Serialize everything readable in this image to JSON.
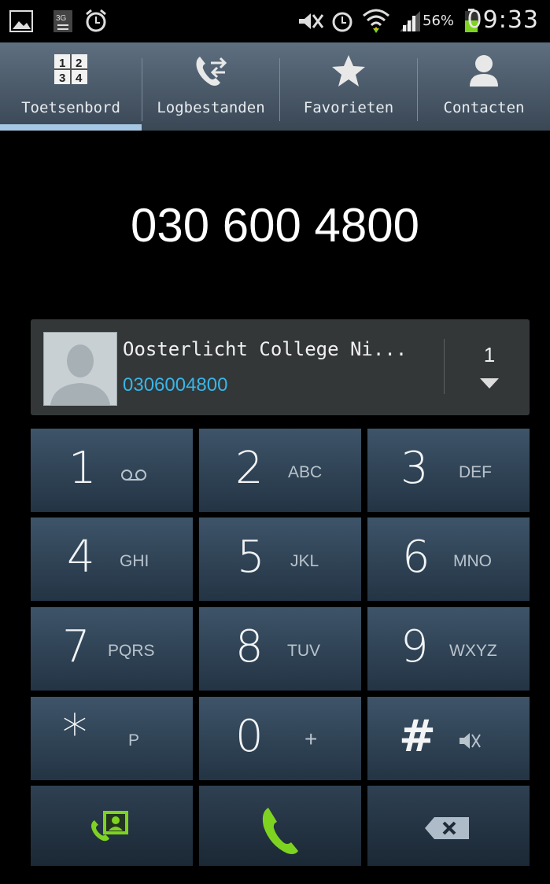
{
  "status_bar": {
    "icons": [
      "image-icon",
      "3g-icon",
      "alarm-clock-icon",
      "mute-icon",
      "alarm-icon",
      "wifi-icon",
      "signal-icon",
      "battery-icon"
    ],
    "battery_percent": "56%",
    "time": "09:33"
  },
  "tabs": [
    {
      "label": "Toetsenbord",
      "icon": "keypad-icon",
      "selected": true
    },
    {
      "label": "Logbestanden",
      "icon": "call-log-icon",
      "selected": false
    },
    {
      "label": "Favorieten",
      "icon": "star-icon",
      "selected": false
    },
    {
      "label": "Contacten",
      "icon": "person-icon",
      "selected": false
    }
  ],
  "dialed_number": "030 600 4800",
  "contact_match": {
    "name": "Oosterlicht College Ni...",
    "number": "0306004800",
    "count": "1"
  },
  "keys": {
    "k1": {
      "digit": "1",
      "letters": "QO"
    },
    "k2": {
      "digit": "2",
      "letters": "ABC"
    },
    "k3": {
      "digit": "3",
      "letters": "DEF"
    },
    "k4": {
      "digit": "4",
      "letters": "GHI"
    },
    "k5": {
      "digit": "5",
      "letters": "JKL"
    },
    "k6": {
      "digit": "6",
      "letters": "MNO"
    },
    "k7": {
      "digit": "7",
      "letters": "PQRS"
    },
    "k8": {
      "digit": "8",
      "letters": "TUV"
    },
    "k9": {
      "digit": "9",
      "letters": "WXYZ"
    },
    "kstar": {
      "digit": "*",
      "letters": "P"
    },
    "k0": {
      "digit": "0",
      "letters": "+"
    },
    "khash": {
      "digit": "#",
      "letters": ""
    }
  },
  "colors": {
    "accent_green": "#7ed321",
    "link_blue": "#39b6e8",
    "tab_indicator": "#a5c7e3"
  }
}
